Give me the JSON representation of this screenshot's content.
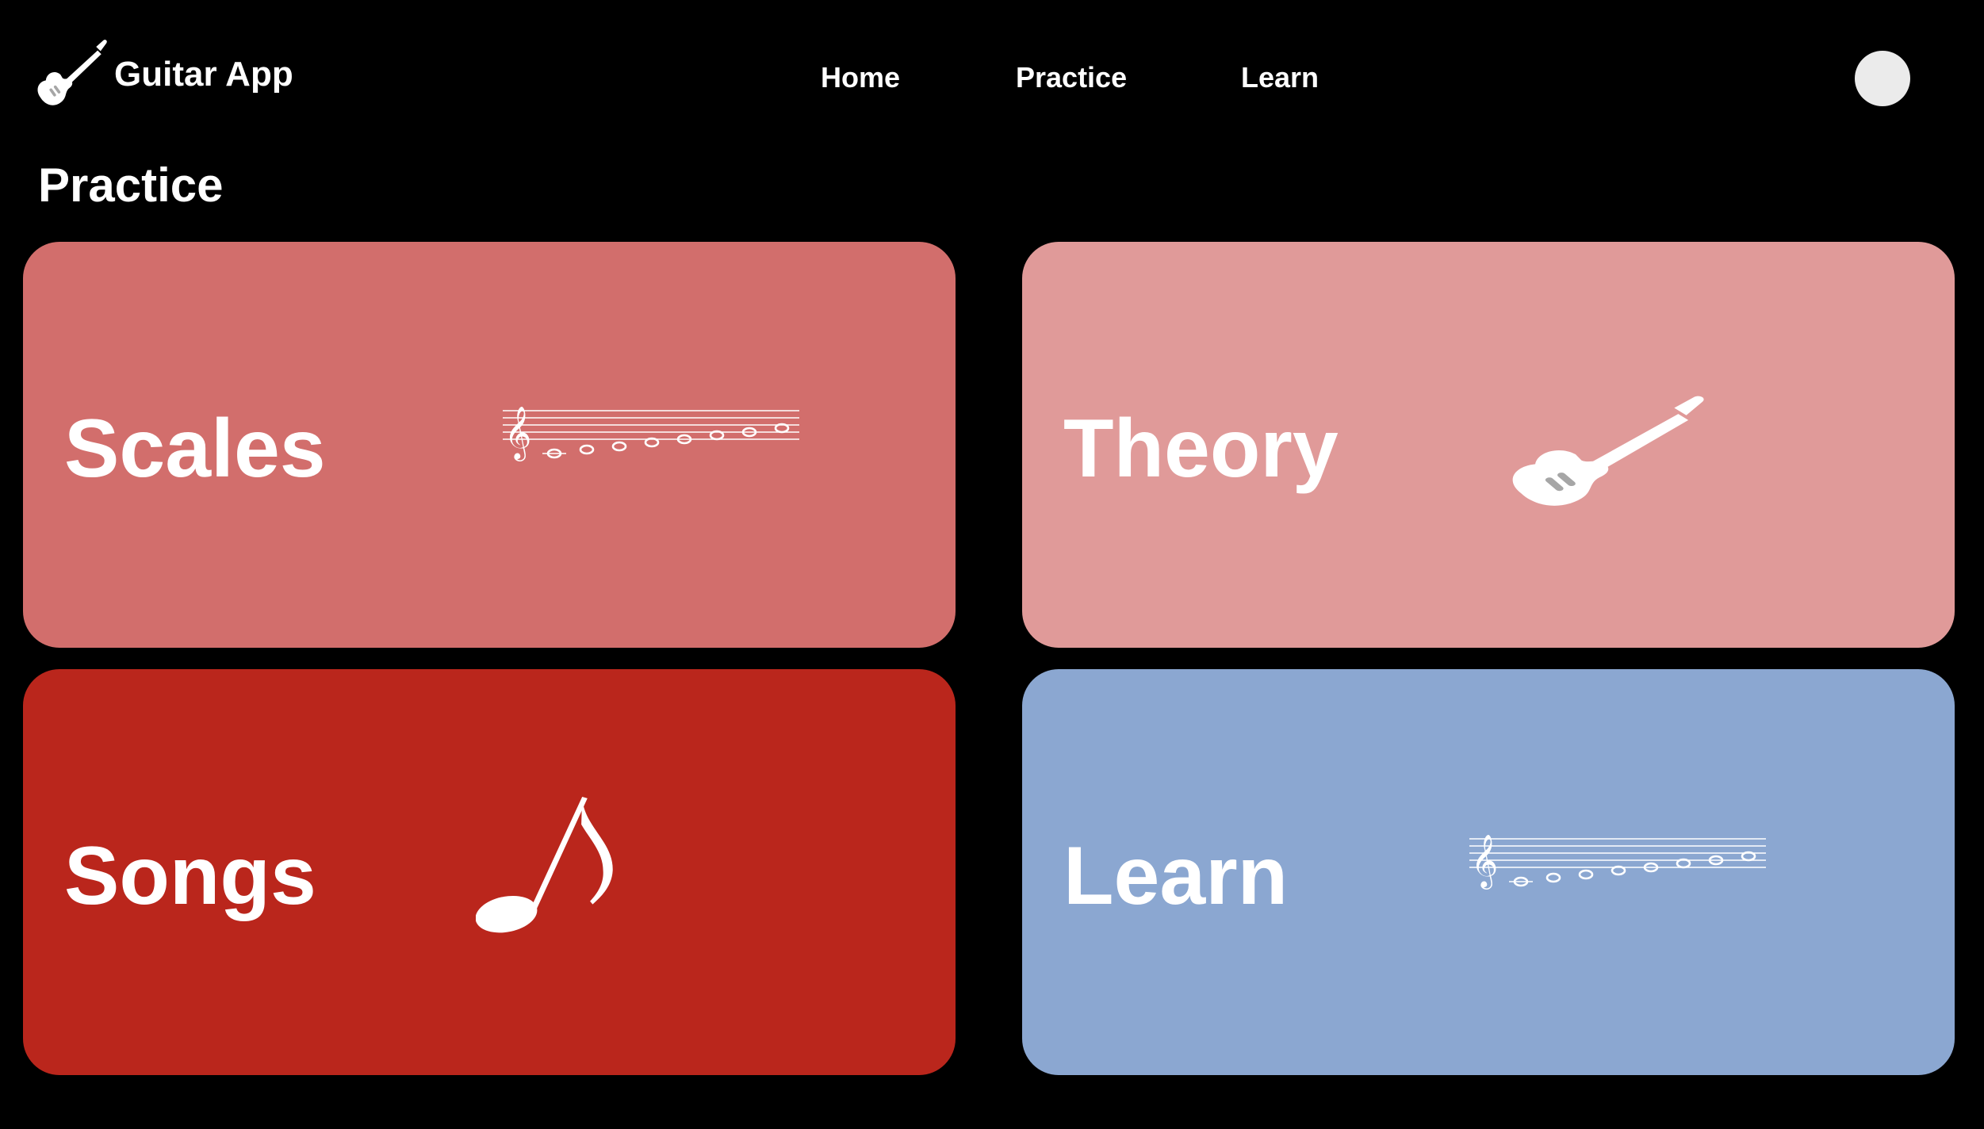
{
  "app": {
    "name": "Guitar App",
    "logo_icon": "electric-guitar-icon"
  },
  "nav": {
    "items": [
      {
        "label": "Home"
      },
      {
        "label": "Practice"
      },
      {
        "label": "Learn"
      }
    ]
  },
  "user": {
    "avatar_icon": "avatar-circle"
  },
  "page": {
    "title": "Practice"
  },
  "tiles": [
    {
      "label": "Scales",
      "icon": "music-staff-scale-icon",
      "color": "#d26e6c"
    },
    {
      "label": "Theory",
      "icon": "electric-guitar-icon",
      "color": "#e09a99"
    },
    {
      "label": "Songs",
      "icon": "eighth-note-icon",
      "color": "#ba261c"
    },
    {
      "label": "Learn",
      "icon": "music-staff-scale-icon",
      "color": "#8ba7d1"
    }
  ],
  "colors": {
    "background": "#000000",
    "text": "#ffffff",
    "avatar": "#ebebeb"
  }
}
